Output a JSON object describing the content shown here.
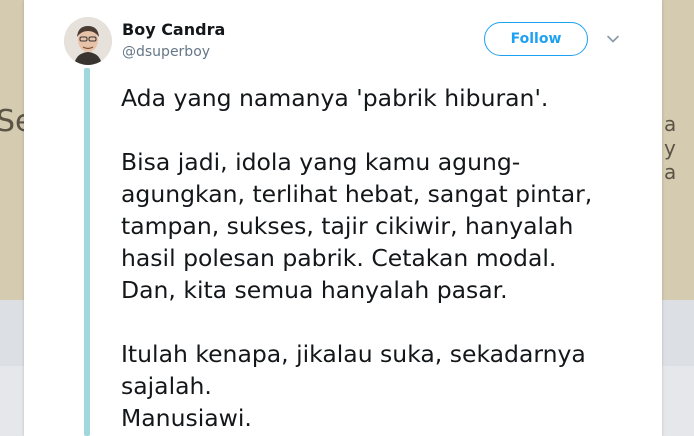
{
  "tweet": {
    "author_name": "Boy Candra",
    "author_handle": "@dsuperboy",
    "follow_label": "Follow",
    "lines": [
      "Ada yang namanya 'pabrik hiburan'.",
      "",
      "Bisa jadi, idola yang kamu agung-",
      "agungkan, terlihat hebat, sangat pintar,",
      "tampan, sukses, tajir cikiwir, hanyalah",
      "hasil polesan pabrik. Cetakan modal.",
      "Dan, kita semua hanyalah pasar.",
      "",
      "Itulah kenapa, jikalau suka, sekadarnya",
      "sajalah.",
      "Manusiawi."
    ]
  },
  "background": {
    "left_fragment": "Se",
    "right_fragments": [
      "a",
      "y",
      "a"
    ]
  },
  "colors": {
    "accent": "#1da1f2",
    "thread_line": "#9fd9dd",
    "text": "#14171a",
    "secondary_text": "#657786"
  },
  "icons": {
    "avatar": "avatar-photo",
    "menu": "chevron-down-icon"
  }
}
